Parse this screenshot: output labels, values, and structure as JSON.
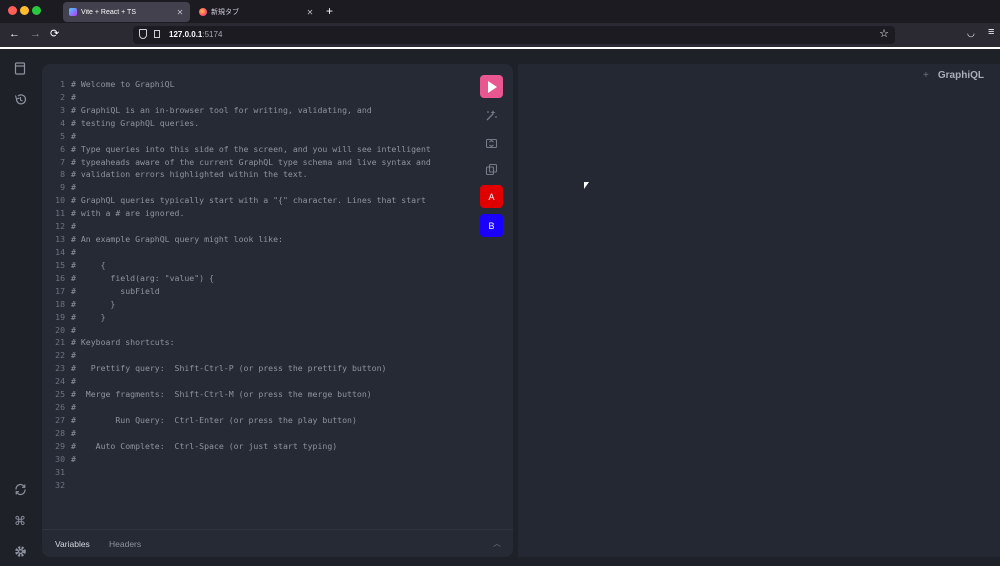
{
  "browser": {
    "tabs": [
      {
        "title": "Vite + React + TS",
        "active": true
      },
      {
        "title": "新規タブ",
        "active": false
      }
    ],
    "new_tab_label": "+",
    "url_host": "127.0.0.1",
    "url_port": ":5174",
    "icons": {
      "back": "←",
      "forward": "→",
      "reload": "⟳",
      "star": "☆",
      "pocket": "◡",
      "menu": "≡",
      "close": "✕"
    }
  },
  "sidebar": {
    "icons": [
      "docs-icon",
      "history-icon",
      "refetch-icon",
      "shortcuts-icon",
      "settings-icon"
    ]
  },
  "editor": {
    "lines": [
      {
        "n": "1",
        "t": "# Welcome to GraphiQL"
      },
      {
        "n": "2",
        "t": "#"
      },
      {
        "n": "3",
        "t": "# GraphiQL is an in-browser tool for writing, validating, and"
      },
      {
        "n": "4",
        "t": "# testing GraphQL queries."
      },
      {
        "n": "5",
        "t": "#"
      },
      {
        "n": "6",
        "t": "# Type queries into this side of the screen, and you will see intelligent"
      },
      {
        "n": "7",
        "t": "# typeaheads aware of the current GraphQL type schema and live syntax and"
      },
      {
        "n": "8",
        "t": "# validation errors highlighted within the text."
      },
      {
        "n": "9",
        "t": "#"
      },
      {
        "n": "10",
        "t": "# GraphQL queries typically start with a \"{\" character. Lines that start"
      },
      {
        "n": "11",
        "t": "# with a # are ignored."
      },
      {
        "n": "12",
        "t": "#"
      },
      {
        "n": "13",
        "t": "# An example GraphQL query might look like:"
      },
      {
        "n": "14",
        "t": "#"
      },
      {
        "n": "15",
        "t": "#     {"
      },
      {
        "n": "16",
        "t": "#       field(arg: \"value\") {"
      },
      {
        "n": "17",
        "t": "#         subField"
      },
      {
        "n": "18",
        "t": "#       }"
      },
      {
        "n": "19",
        "t": "#     }"
      },
      {
        "n": "20",
        "t": "#"
      },
      {
        "n": "21",
        "t": "# Keyboard shortcuts:"
      },
      {
        "n": "22",
        "t": "#"
      },
      {
        "n": "23",
        "t": "#   Prettify query:  Shift-Ctrl-P (or press the prettify button)"
      },
      {
        "n": "24",
        "t": "#"
      },
      {
        "n": "25",
        "t": "#  Merge fragments:  Shift-Ctrl-M (or press the merge button)"
      },
      {
        "n": "26",
        "t": "#"
      },
      {
        "n": "27",
        "t": "#        Run Query:  Ctrl-Enter (or press the play button)"
      },
      {
        "n": "28",
        "t": "#"
      },
      {
        "n": "29",
        "t": "#    Auto Complete:  Ctrl-Space (or just start typing)"
      },
      {
        "n": "30",
        "t": "#"
      },
      {
        "n": "31",
        "t": ""
      },
      {
        "n": "32",
        "t": ""
      }
    ],
    "toolbar": {
      "a_label": "A",
      "b_label": "B",
      "colors": {
        "play": "#e8578f",
        "a": "#e00000",
        "b": "#1a00ff"
      }
    },
    "bottom_tabs": {
      "variables": "Variables",
      "headers": "Headers"
    }
  },
  "results": {
    "brand": "GraphiQL",
    "plus": "+"
  }
}
